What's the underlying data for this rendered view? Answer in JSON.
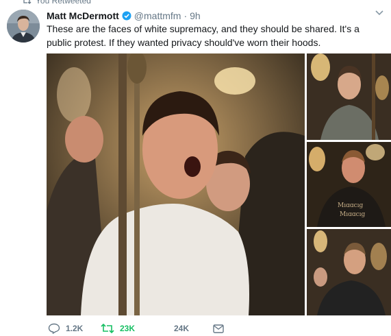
{
  "retweet_context": {
    "label": "You Retweeted",
    "icon": "retweet-icon"
  },
  "tweet": {
    "author_name": "Matt McDermott",
    "verified_icon": "verified-badge-icon",
    "handle": "@mattmfm",
    "separator": "·",
    "time": "9h",
    "text": "These are the faces of white supremacy, and they should be shared. It's a public protest. If they wanted privacy should've worn their hoods.",
    "media": [
      {
        "position": "main",
        "description_icon": "photo"
      },
      {
        "position": "top-right",
        "description_icon": "photo"
      },
      {
        "position": "middle-right",
        "description_icon": "photo"
      },
      {
        "position": "bottom-right",
        "description_icon": "photo"
      }
    ],
    "actions": {
      "reply_count": "1.2K",
      "retweet_count": "23K",
      "like_count": "24K"
    }
  },
  "colors": {
    "text": "#14171a",
    "secondary": "#657786",
    "retweeted_green": "#17bf63",
    "verified_blue": "#1da1f2"
  }
}
